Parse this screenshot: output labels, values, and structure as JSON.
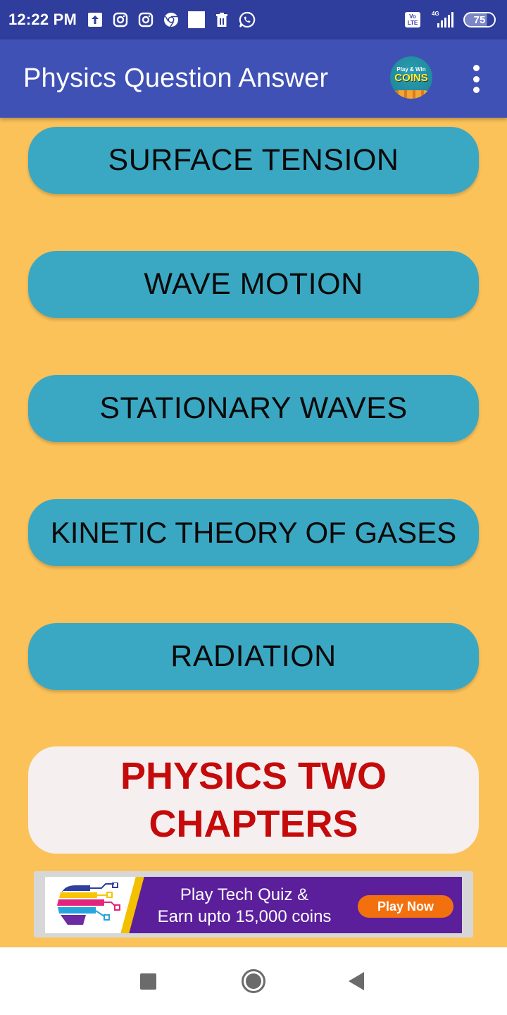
{
  "status_bar": {
    "time": "12:22 PM",
    "notification_icons": [
      "upload-icon",
      "instagram-icon",
      "instagram-icon",
      "chrome-icon",
      "blank-square-icon",
      "trash-icon",
      "whatsapp-icon"
    ],
    "volte_label_top": "Vo",
    "volte_label_bottom": "LTE",
    "network_type": "4G",
    "battery_level": "75"
  },
  "app_bar": {
    "title": "Physics Question Answer",
    "coins_badge": {
      "line1": "Play & Win",
      "line2": "COINS"
    }
  },
  "chapters": [
    {
      "label": "SURFACE TENSION"
    },
    {
      "label": "WAVE MOTION"
    },
    {
      "label": "STATIONARY WAVES"
    },
    {
      "label": "KINETIC THEORY OF GASES"
    },
    {
      "label": "RADIATION"
    }
  ],
  "physics_two_button": {
    "label": "PHYSICS TWO CHAPTERS"
  },
  "ad_banner": {
    "text_line1": "Play Tech Quiz &",
    "text_line2": "Earn upto 15,000 coins",
    "cta_label": "Play Now"
  },
  "colors": {
    "background": "#fcc25a",
    "app_bar": "#3f51b5",
    "status_bar": "#2f3d9c",
    "chapter_button": "#3ba8c3",
    "physics_two_text": "#c40a0a",
    "physics_two_bg": "#f5f0ef",
    "ad_bg": "#5b1f9c",
    "ad_cta": "#f3700f"
  }
}
